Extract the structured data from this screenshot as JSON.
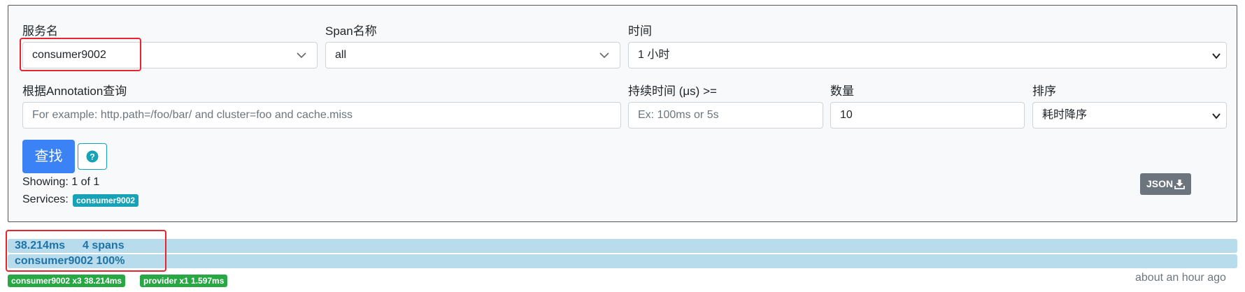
{
  "form": {
    "service_label": "服务名",
    "service_value": "consumer9002",
    "span_label": "Span名称",
    "span_value": "all",
    "time_label": "时间",
    "time_value": "1 小时",
    "annotation_label": "根据Annotation查询",
    "annotation_placeholder": "For example: http.path=/foo/bar/ and cluster=foo and cache.miss",
    "duration_label": "持续时间 (μs) >=",
    "duration_placeholder": "Ex: 100ms or 5s",
    "limit_label": "数量",
    "limit_value": "10",
    "sort_label": "排序",
    "sort_value": "耗时降序",
    "search_button": "查找",
    "help_icon": "question-circle-icon"
  },
  "results": {
    "showing": "Showing: 1 of 1",
    "services_label": "Services:",
    "services": [
      "consumer9002"
    ],
    "json_button": "JSON",
    "json_icon": "download-icon"
  },
  "trace": {
    "duration": "38.214ms",
    "spans": "4 spans",
    "service_pct": "consumer9002 100%",
    "badges": [
      "consumer9002 x3 38.214ms",
      "provider x1 1.597ms"
    ],
    "time_ago": "about an hour ago"
  },
  "colors": {
    "primary": "#3b82f6",
    "info": "#17a2b8",
    "success": "#28a745",
    "secondary": "#6c757d",
    "bar": "#b8dcec",
    "highlight": "#e8242e"
  }
}
